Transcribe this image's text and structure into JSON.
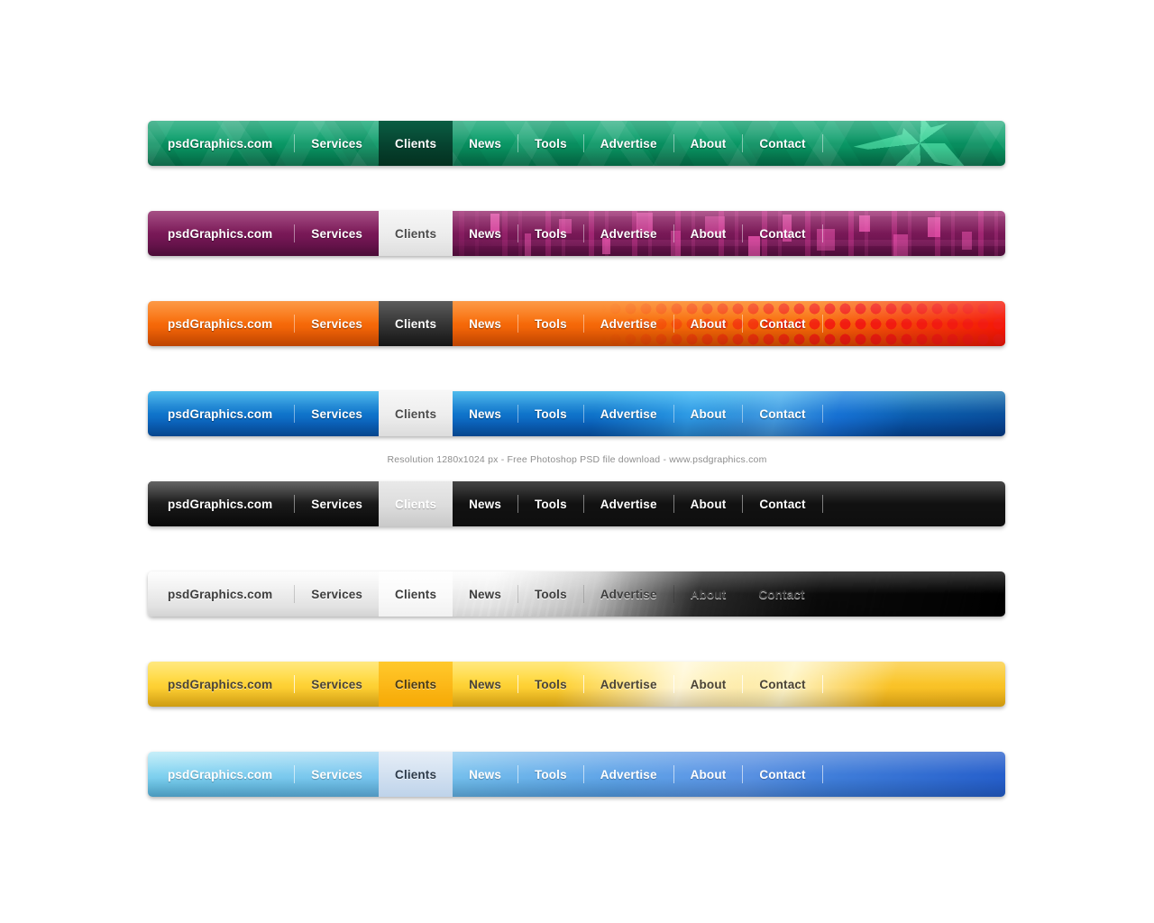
{
  "caption": "Resolution 1280x1024 px - Free Photoshop PSD file download - www.psdgraphics.com",
  "nav_labels": {
    "brand": "psdGraphics.com",
    "services": "Services",
    "clients": "Clients",
    "news": "News",
    "tools": "Tools",
    "advertise": "Advertise",
    "about": "About",
    "contact": "Contact"
  },
  "active_item": "Clients",
  "bars": [
    {
      "id": "green",
      "theme_name": "green-stars",
      "accent": "#0c9f6c",
      "active_tab_color": "#06422f",
      "text_color": "#ffffff",
      "items": [
        "psdGraphics.com",
        "Services",
        "Clients",
        "News",
        "Tools",
        "Advertise",
        "About",
        "Contact"
      ]
    },
    {
      "id": "purple",
      "theme_name": "purple-pixels",
      "accent": "#7d1a59",
      "active_tab_color": "#ececec",
      "text_color": "#ffffff",
      "items": [
        "psdGraphics.com",
        "Services",
        "Clients",
        "News",
        "Tools",
        "Advertise",
        "About",
        "Contact"
      ]
    },
    {
      "id": "orange",
      "theme_name": "orange-halftone",
      "accent": "#f9700c",
      "active_tab_color": "#3a3a3a",
      "text_color": "#ffffff",
      "items": [
        "psdGraphics.com",
        "Services",
        "Clients",
        "News",
        "Tools",
        "Advertise",
        "About",
        "Contact"
      ]
    },
    {
      "id": "blue",
      "theme_name": "blue-waves",
      "accent": "#1484d4",
      "active_tab_color": "#ededed",
      "text_color": "#ffffff",
      "items": [
        "psdGraphics.com",
        "Services",
        "Clients",
        "News",
        "Tools",
        "Advertise",
        "About",
        "Contact"
      ]
    },
    {
      "id": "rainbow",
      "theme_name": "black-rainbow-stripes",
      "accent": "#1d1d1d",
      "active_tab_color": "#dcdcdc",
      "text_color": "#ffffff",
      "items": [
        "psdGraphics.com",
        "Services",
        "Clients",
        "News",
        "Tools",
        "Advertise",
        "About",
        "Contact"
      ]
    },
    {
      "id": "gray",
      "theme_name": "white-grunge",
      "accent": "#f0f0f0",
      "active_tab_color": "#fafafa",
      "text_color": "#3d3d3d",
      "items": [
        "psdGraphics.com",
        "Services",
        "Clients",
        "News",
        "Tools",
        "Advertise",
        "About",
        "Contact"
      ]
    },
    {
      "id": "yellow",
      "theme_name": "yellow-silk",
      "accent": "#ffd93f",
      "active_tab_color": "#fcb919",
      "text_color": "#4a4334",
      "items": [
        "psdGraphics.com",
        "Services",
        "Clients",
        "News",
        "Tools",
        "Advertise",
        "About",
        "Contact"
      ]
    },
    {
      "id": "lightblue",
      "theme_name": "light-blue-gradient",
      "accent": "#8fd9f2",
      "active_tab_color": "#d3e1f1",
      "text_color": "#ffffff",
      "items": [
        "psdGraphics.com",
        "Services",
        "Clients",
        "News",
        "Tools",
        "Advertise",
        "About",
        "Contact"
      ]
    }
  ]
}
